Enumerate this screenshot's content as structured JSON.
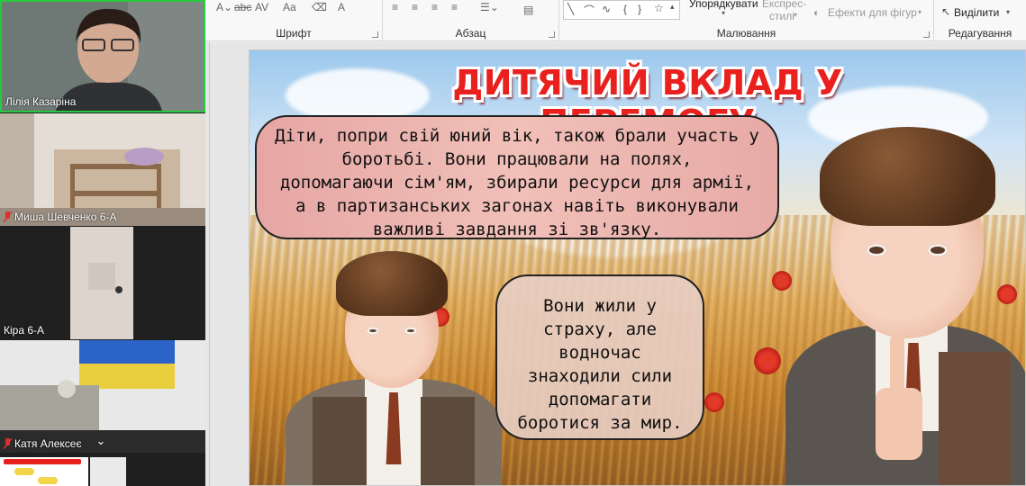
{
  "ribbon": {
    "font_group": "Шрифт",
    "paragraph_group": "Абзац",
    "drawing_group": "Малювання",
    "editing_group": "Редагування",
    "arrange_label": "Упорядкувати",
    "quick_styles_line1": "Експрес-",
    "quick_styles_line2": "стилі",
    "shape_effects_label": "Ефекти для фігур",
    "select_label": "Виділити",
    "strike_label": "abc",
    "spacing_label": "AV",
    "case_label": "Aa",
    "font_color_label": "A"
  },
  "slide": {
    "title": "ДИТЯЧИЙ ВКЛАД У ПЕРЕМОГУ",
    "bubble1_lines": [
      "Діти, попри свій юний вік, також брали участь у",
      "боротьбі. Вони працювали на полях,",
      "допомагаючи сім'ям, збирали ресурси для армії,",
      "а в партизанських загонах навіть виконували",
      "важливі завдання зі зв'язку."
    ],
    "bubble2_lines": [
      "Вони жили у",
      "страху, але",
      "водночас",
      "знаходили сили",
      "допомагати",
      "боротися за мир."
    ]
  },
  "participants": [
    {
      "name": "Лілія Казаріна",
      "muted": false
    },
    {
      "name": "Миша Шевченко 6-А",
      "muted": true
    },
    {
      "name": "Кіра 6-А",
      "muted": false
    },
    {
      "name": "Катя Алексеє",
      "muted": true
    }
  ],
  "colors": {
    "title_red": "#e8201e",
    "active_speaker_border": "#27c93f",
    "mute_red": "#e0302a"
  }
}
